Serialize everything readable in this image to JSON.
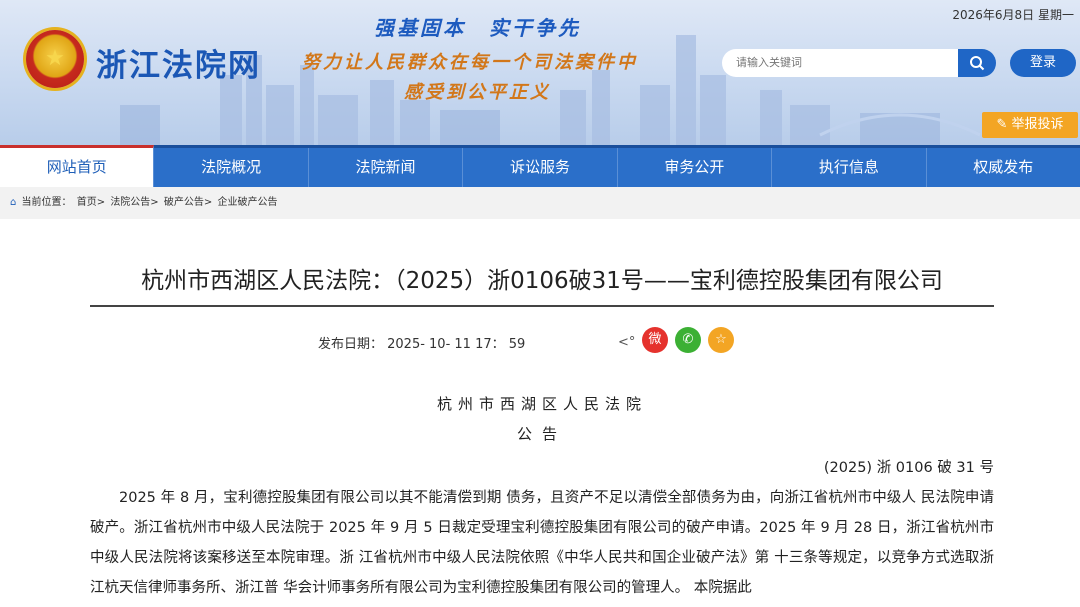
{
  "header": {
    "date": "2026年6月8日 星期一",
    "site_title": "浙江法院网",
    "slogan_top": "强基固本　实干争先",
    "slogan_line1": "努力让人民群众在每一个司法案件中",
    "slogan_line2": "感受到公平正义",
    "search_placeholder": "请输入关键词",
    "login_label": "登录",
    "report_label": "举报投诉"
  },
  "nav": {
    "items": [
      {
        "label": "网站首页"
      },
      {
        "label": "法院概况"
      },
      {
        "label": "法院新闻"
      },
      {
        "label": "诉讼服务"
      },
      {
        "label": "审务公开"
      },
      {
        "label": "执行信息"
      },
      {
        "label": "权威发布"
      }
    ]
  },
  "breadcrumb": {
    "prefix": "当前位置：",
    "items": [
      "首页>",
      "法院公告>",
      "破产公告>",
      "企业破产公告"
    ]
  },
  "article": {
    "title": "杭州市西湖区人民法院：（2025）浙0106破31号——宝利德控股集团有限公司",
    "pubdate": "发布日期：  2025- 10- 11 17：  59",
    "court": "杭州市西湖区人民法院",
    "notice": "公告",
    "case_no": "(2025) 浙 0106 破 31 号",
    "body": "2025 年 8 月，宝利德控股集团有限公司以其不能清偿到期 债务，且资产不足以清偿全部债务为由，向浙江省杭州市中级人 民法院申请破产。浙江省杭州市中级人民法院于 2025 年 9 月 5 日裁定受理宝利德控股集团有限公司的破产申请。2025 年 9 月 28 日，浙江省杭州市中级人民法院将该案移送至本院审理。浙 江省杭州市中级人民法院依照《中华人民共和国企业破产法》第 十三条等规定，以竞争方式选取浙江杭天信律师事务所、浙江普 华会计师事务所有限公司为宝利德控股集团有限公司的管理人。 本院据此"
  },
  "colors": {
    "nav_bg": "#2b6fc9",
    "accent_orange": "#d2771a",
    "title_blue": "#1b57b5",
    "weibo": "#e5322d",
    "wechat": "#3cb034",
    "favorite": "#f3a524"
  },
  "icons": {
    "share": "share-icon",
    "weibo": "weibo-icon",
    "wechat": "wechat-icon",
    "favorite": "star-icon",
    "home": "home-icon",
    "search": "search-icon",
    "report": "edit-icon"
  }
}
